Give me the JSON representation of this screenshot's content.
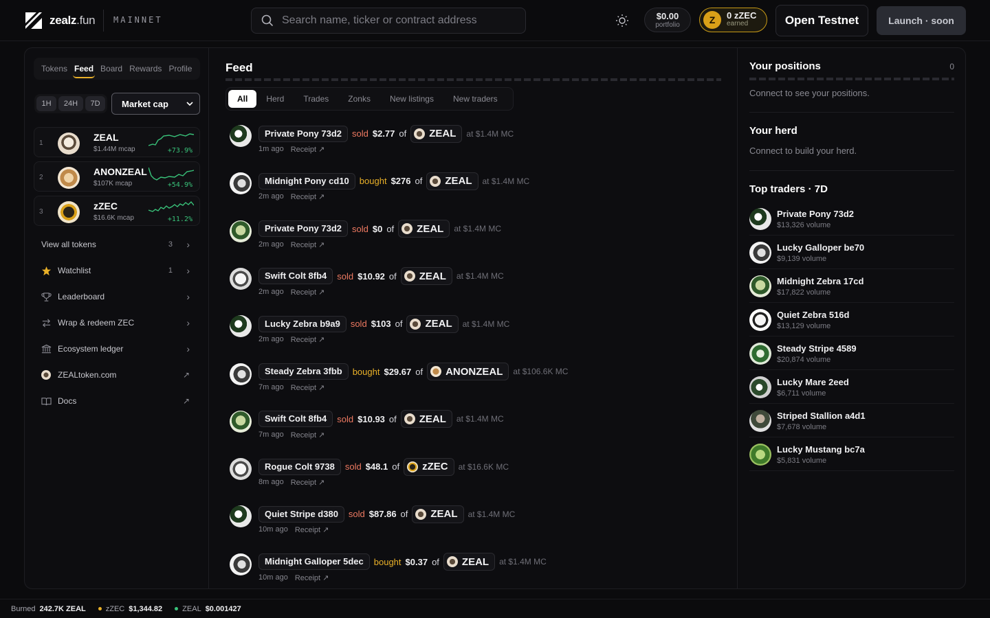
{
  "header": {
    "logo_text": "zealz",
    "logo_suffix": ".fun",
    "network": "MAINNET",
    "search_placeholder": "Search name, ticker or contract address",
    "portfolio_value": "$0.00",
    "portfolio_label": "portfolio",
    "earned_value": "0 zZEC",
    "earned_label": "earned",
    "earned_coin": "Z",
    "open_testnet": "Open Testnet",
    "launch": "Launch · soon"
  },
  "sidebar": {
    "tabs": [
      "Tokens",
      "Feed",
      "Board",
      "Rewards",
      "Profile"
    ],
    "active_tab": "Feed",
    "timeframes": [
      "1H",
      "24H",
      "7D"
    ],
    "sort": "Market cap",
    "tokens": [
      {
        "rank": "1",
        "name": "ZEAL",
        "mcap": "$1.44M mcap",
        "change": "+73.9%"
      },
      {
        "rank": "2",
        "name": "ANONZEAL",
        "mcap": "$107K mcap",
        "change": "+54.9%"
      },
      {
        "rank": "3",
        "name": "zZEC",
        "mcap": "$16.6K mcap",
        "change": "+11.2%"
      }
    ],
    "nav": [
      {
        "label": "View all tokens",
        "count": "3",
        "icon": "none"
      },
      {
        "label": "Watchlist",
        "count": "1",
        "icon": "star-icon"
      },
      {
        "label": "Leaderboard",
        "count": "",
        "icon": "trophy-icon"
      },
      {
        "label": "Wrap & redeem ZEC",
        "count": "",
        "icon": "swap-icon"
      },
      {
        "label": "Ecosystem ledger",
        "count": "",
        "icon": "bank-icon"
      },
      {
        "label": "ZEALtoken.com",
        "count": "",
        "icon": "zeal-logo-icon"
      },
      {
        "label": "Docs",
        "count": "",
        "icon": "book-icon"
      }
    ]
  },
  "feed": {
    "title": "Feed",
    "tabs": [
      "All",
      "Herd",
      "Trades",
      "Zonks",
      "New listings",
      "New traders"
    ],
    "active_tab": "All",
    "receipt_label": "Receipt ↗",
    "items": [
      {
        "trader": "Private Pony 73d2",
        "action": "sold",
        "amount": "$2.77",
        "of": "of",
        "token": "ZEAL",
        "at": "at $1.4M MC",
        "time": "1m ago"
      },
      {
        "trader": "Midnight Pony cd10",
        "action": "bought",
        "amount": "$276",
        "of": "of",
        "token": "ZEAL",
        "at": "at $1.4M MC",
        "time": "2m ago"
      },
      {
        "trader": "Private Pony 73d2",
        "action": "sold",
        "amount": "$0",
        "of": "of",
        "token": "ZEAL",
        "at": "at $1.4M MC",
        "time": "2m ago"
      },
      {
        "trader": "Swift Colt 8fb4",
        "action": "sold",
        "amount": "$10.92",
        "of": "of",
        "token": "ZEAL",
        "at": "at $1.4M MC",
        "time": "2m ago"
      },
      {
        "trader": "Lucky Zebra b9a9",
        "action": "sold",
        "amount": "$103",
        "of": "of",
        "token": "ZEAL",
        "at": "at $1.4M MC",
        "time": "2m ago"
      },
      {
        "trader": "Steady Zebra 3fbb",
        "action": "bought",
        "amount": "$29.67",
        "of": "of",
        "token": "ANONZEAL",
        "at": "at $106.6K MC",
        "time": "7m ago"
      },
      {
        "trader": "Swift Colt 8fb4",
        "action": "sold",
        "amount": "$10.93",
        "of": "of",
        "token": "ZEAL",
        "at": "at $1.4M MC",
        "time": "7m ago"
      },
      {
        "trader": "Rogue Colt 9738",
        "action": "sold",
        "amount": "$48.1",
        "of": "of",
        "token": "zZEC",
        "at": "at $16.6K MC",
        "time": "8m ago"
      },
      {
        "trader": "Quiet Stripe d380",
        "action": "sold",
        "amount": "$87.86",
        "of": "of",
        "token": "ZEAL",
        "at": "at $1.4M MC",
        "time": "10m ago"
      },
      {
        "trader": "Midnight Galloper 5dec",
        "action": "bought",
        "amount": "$0.37",
        "of": "of",
        "token": "ZEAL",
        "at": "at $1.4M MC",
        "time": "10m ago"
      }
    ]
  },
  "right": {
    "positions_title": "Your positions",
    "positions_count": "0",
    "positions_sub": "Connect to see your positions.",
    "herd_title": "Your herd",
    "herd_sub": "Connect to build your herd.",
    "traders_title": "Top traders · 7D",
    "traders": [
      {
        "name": "Private Pony 73d2",
        "volume": "$13,326 volume"
      },
      {
        "name": "Lucky Galloper be70",
        "volume": "$9,139 volume"
      },
      {
        "name": "Midnight Zebra 17cd",
        "volume": "$17,822 volume"
      },
      {
        "name": "Quiet Zebra 516d",
        "volume": "$13,129 volume"
      },
      {
        "name": "Steady Stripe 4589",
        "volume": "$20,874 volume"
      },
      {
        "name": "Lucky Mare 2eed",
        "volume": "$6,711 volume"
      },
      {
        "name": "Striped Stallion a4d1",
        "volume": "$7,678 volume"
      },
      {
        "name": "Lucky Mustang bc7a",
        "volume": "$5,831 volume"
      }
    ]
  },
  "ticker": {
    "burned_label": "Burned",
    "burned_value": "242.7K ZEAL",
    "zzec_label": "zZEC",
    "zzec_value": "$1,344.82",
    "zeal_label": "ZEAL",
    "zeal_value": "$0.001427"
  },
  "colors": {
    "accent": "#e9b028",
    "sold": "#ef7a62",
    "up": "#39c37a",
    "bg": "#0b0b0d"
  }
}
